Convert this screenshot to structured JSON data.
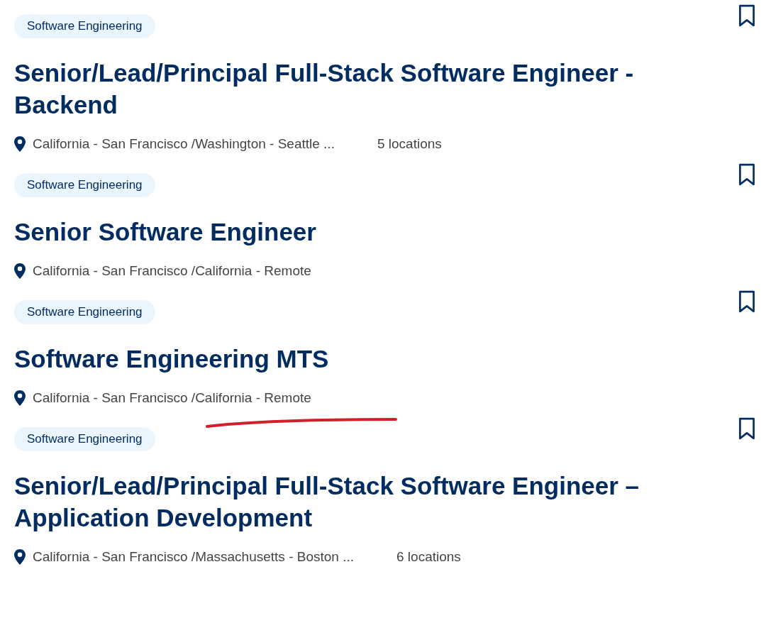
{
  "jobs": [
    {
      "category": "Software Engineering",
      "title": "Senior/Lead/Principal Full-Stack Software Engineer - Backend",
      "locations": "California - San Francisco /Washington - Seattle ...",
      "location_count": "5 locations",
      "bookmarked": false,
      "underlined": false
    },
    {
      "category": "Software Engineering",
      "title": "Senior Software Engineer",
      "locations": "California - San Francisco /California - Remote",
      "bookmarked": false,
      "underlined": false
    },
    {
      "category": "Software Engineering",
      "title": "Software Engineering MTS",
      "locations": "California - San Francisco /California - Remote",
      "bookmarked": false,
      "underlined": true
    },
    {
      "category": "Software Engineering",
      "title": "Senior/Lead/Principal Full-Stack Software Engineer – Application Development",
      "locations": "California - San Francisco /Massachusetts - Boston ...",
      "location_count": "6 locations",
      "bookmarked": false,
      "underlined": false
    }
  ]
}
